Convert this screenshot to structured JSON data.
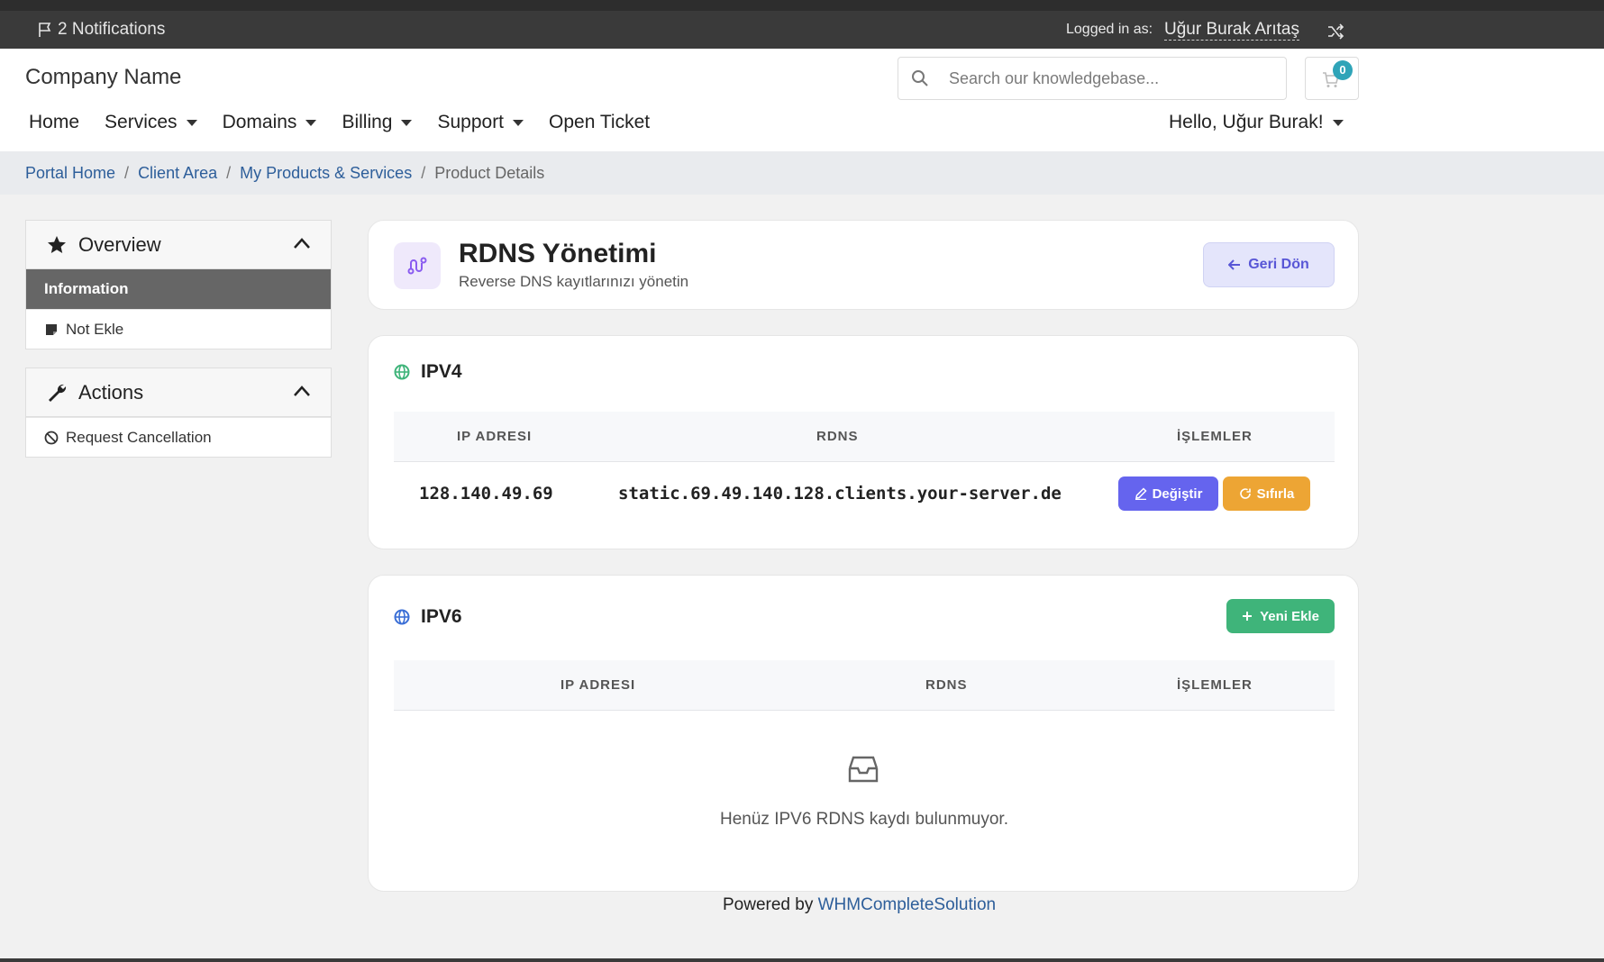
{
  "topbar": {
    "notifications": "2 Notifications",
    "logged_in_label": "Logged in as:",
    "username": "Uğur Burak Arıtaş"
  },
  "header": {
    "company": "Company Name",
    "search_placeholder": "Search our knowledgebase...",
    "cart_count": "0"
  },
  "nav": {
    "items": [
      {
        "label": "Home"
      },
      {
        "label": "Services"
      },
      {
        "label": "Domains"
      },
      {
        "label": "Billing"
      },
      {
        "label": "Support"
      },
      {
        "label": "Open Ticket"
      }
    ],
    "hello": "Hello, Uğur Burak!"
  },
  "breadcrumb": [
    "Portal Home",
    "Client Area",
    "My Products & Services",
    "Product Details"
  ],
  "sidebar": {
    "overview_title": "Overview",
    "overview_items": [
      "Information",
      "Not Ekle"
    ],
    "actions_title": "Actions",
    "actions_items": [
      "Request Cancellation"
    ]
  },
  "page": {
    "title": "RDNS Yönetimi",
    "subtitle": "Reverse DNS kayıtlarınızı yönetin",
    "back_label": "Geri Dön"
  },
  "ipv4": {
    "title": "IPV4",
    "headers": [
      "IP ADRESI",
      "RDNS",
      "İŞLEMLER"
    ],
    "rows": [
      {
        "ip": "128.140.49.69",
        "rdns": "static.69.49.140.128.clients.your-server.de",
        "edit": "Değiştir",
        "reset": "Sıfırla"
      }
    ]
  },
  "ipv6": {
    "title": "IPV6",
    "new_label": "Yeni Ekle",
    "headers": [
      "IP ADRESI",
      "RDNS",
      "İŞLEMLER"
    ],
    "empty": "Henüz IPV6 RDNS kaydı bulunmuyor."
  },
  "footer": {
    "powered_by": "Powered by",
    "link": "WHMCompleteSolution"
  },
  "colors": {
    "topbar": "#3a3a3a",
    "accent_purple": "#6564ee",
    "warning": "#eda534",
    "success": "#3fb47a",
    "link": "#2d5e9a"
  }
}
